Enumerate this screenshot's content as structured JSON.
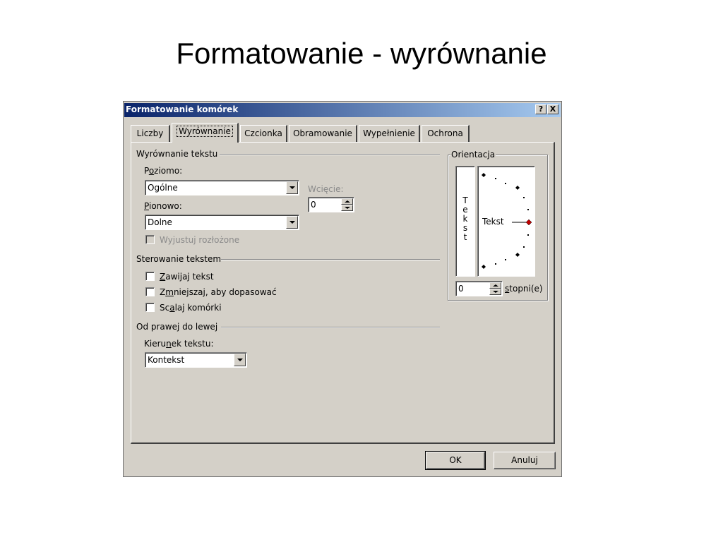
{
  "slide": {
    "title": "Formatowanie - wyrównanie"
  },
  "dialog": {
    "title": "Formatowanie komórek",
    "help_button": "?",
    "close_button": "X",
    "tabs": [
      {
        "label": "Liczby"
      },
      {
        "label": "Wyrównanie"
      },
      {
        "label": "Czcionka"
      },
      {
        "label": "Obramowanie"
      },
      {
        "label": "Wypełnienie"
      },
      {
        "label": "Ochrona"
      }
    ],
    "alignment": {
      "group_label": "Wyrównanie tekstu",
      "horizontal_label_pre": "P",
      "horizontal_label_u": "o",
      "horizontal_label_post": "ziomo:",
      "horizontal_value": "Ogólne",
      "indent_label": "Wcięcie:",
      "indent_value": "0",
      "vertical_label_u": "P",
      "vertical_label_post": "ionowo:",
      "vertical_value": "Dolne",
      "justify_distributed": "Wyjustuj rozłożone"
    },
    "text_control": {
      "group_label": "Sterowanie tekstem",
      "wrap_u": "Z",
      "wrap_post": "awijaj tekst",
      "shrink_pre": "Z",
      "shrink_u": "m",
      "shrink_post": "niejszaj, aby dopasować",
      "merge_pre": "Sc",
      "merge_u": "a",
      "merge_post": "laj komórki"
    },
    "rtl": {
      "group_label": "Od prawej do lewej",
      "direction_pre": "Kieru",
      "direction_u": "n",
      "direction_post": "ek tekstu:",
      "direction_value": "Kontekst"
    },
    "orientation": {
      "group_label": "Orientacja",
      "vertical_letters": [
        "T",
        "e",
        "k",
        "s",
        "t"
      ],
      "sample_text": "Tekst",
      "degrees_value": "0",
      "degrees_label_u": "s",
      "degrees_label_post": "topni(e)",
      "selected_marker_color": "#c00000"
    },
    "ok_label": "OK",
    "cancel_label": "Anuluj"
  }
}
